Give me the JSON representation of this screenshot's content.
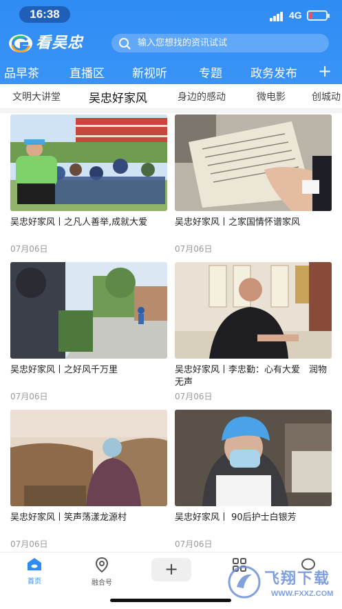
{
  "status_bar": {
    "time": "16:38",
    "network": "4G",
    "battery_level": 0.2
  },
  "header": {
    "app_name": "看吴忠",
    "search_placeholder": "输入您想找的资讯试试"
  },
  "channels": [
    "品早茶",
    "直播区",
    "新视听",
    "专题",
    "政务发布"
  ],
  "channel_add_icon": "plus-icon",
  "subtabs": {
    "items": [
      "文明大讲堂",
      "吴忠好家风",
      "身边的感动",
      "微电影",
      "创城动"
    ],
    "active": "吴忠好家风"
  },
  "articles": [
    {
      "title": "吴忠好家风丨之凡人善举,成就大爱",
      "date": "07月06日"
    },
    {
      "title": "吴忠好家风丨之家国情怀谱家风",
      "date": "07月06日"
    },
    {
      "title": "吴忠好家风丨之好风千万里",
      "date": "07月06日"
    },
    {
      "title": "吴忠好家风丨李忠勤：心有大爱　润物无声",
      "date": "07月06日"
    },
    {
      "title": "吴忠好家风丨笑声荡漾龙源村",
      "date": "07月06日"
    },
    {
      "title": "吴忠好家风丨 90后护士白银芳",
      "date": "07月06日"
    }
  ],
  "bottom_nav": {
    "home": "首页",
    "fusion": "融合号",
    "plus_icon": "plus-icon",
    "apps_icon": "grid-icon",
    "chat_icon": "chat-icon"
  },
  "watermark": {
    "text": "飞翔下载",
    "url": "WWW.FXXZ.COM"
  },
  "colors": {
    "header_blue": "#2f8cf4",
    "active_nav": "#2f8cf4",
    "date_gray": "#999999"
  }
}
